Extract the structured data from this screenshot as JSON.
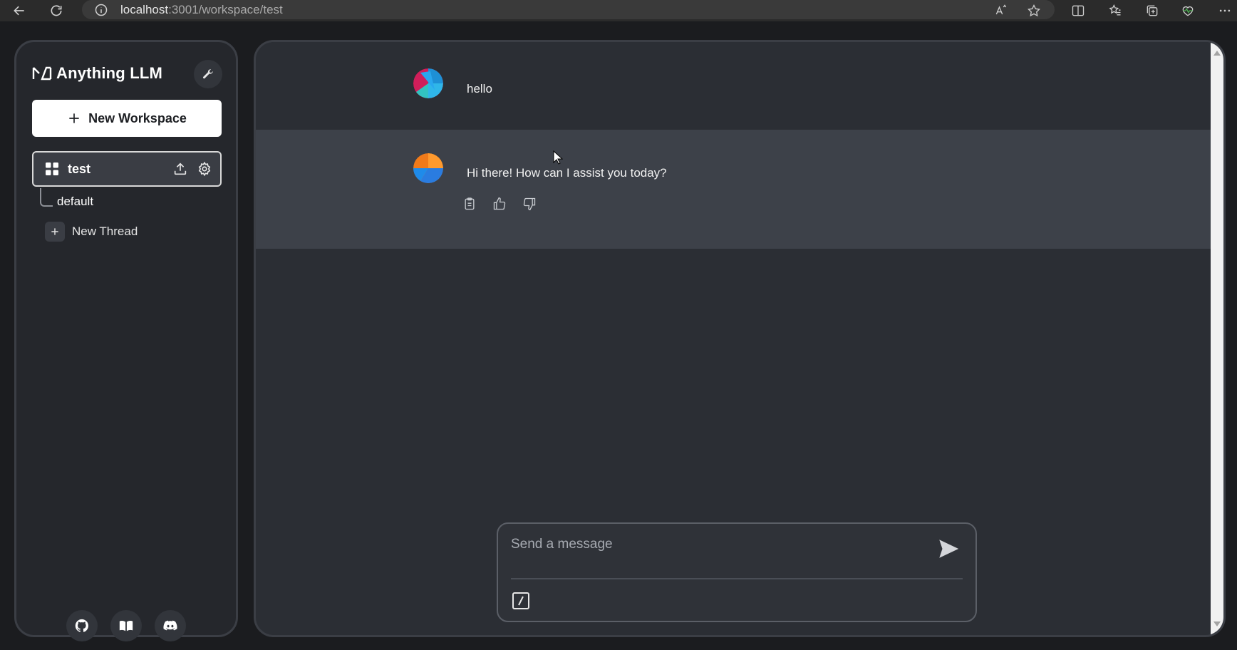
{
  "browser": {
    "url_host": "localhost",
    "url_path": ":3001/workspace/test"
  },
  "sidebar": {
    "app_name": "Anything LLM",
    "new_workspace_label": "New Workspace",
    "workspace": {
      "name": "test",
      "threads": [
        {
          "label": "default"
        }
      ]
    },
    "new_thread_label": "New Thread",
    "footer_icons": [
      "github-icon",
      "docs-icon",
      "discord-icon"
    ]
  },
  "chat": {
    "messages": [
      {
        "role": "user",
        "text": "hello"
      },
      {
        "role": "assistant",
        "text": "Hi there! How can I assist you today?"
      }
    ],
    "message_actions": [
      "copy-icon",
      "thumbs-up-icon",
      "thumbs-down-icon"
    ]
  },
  "composer": {
    "placeholder": "Send a message"
  },
  "colors": {
    "page_bg": "#1b1c1f",
    "sidebar_bg": "#25272c",
    "chat_bg": "#2b2e34",
    "assistant_row_bg": "#3d4149",
    "accent_white": "#ffffff"
  }
}
